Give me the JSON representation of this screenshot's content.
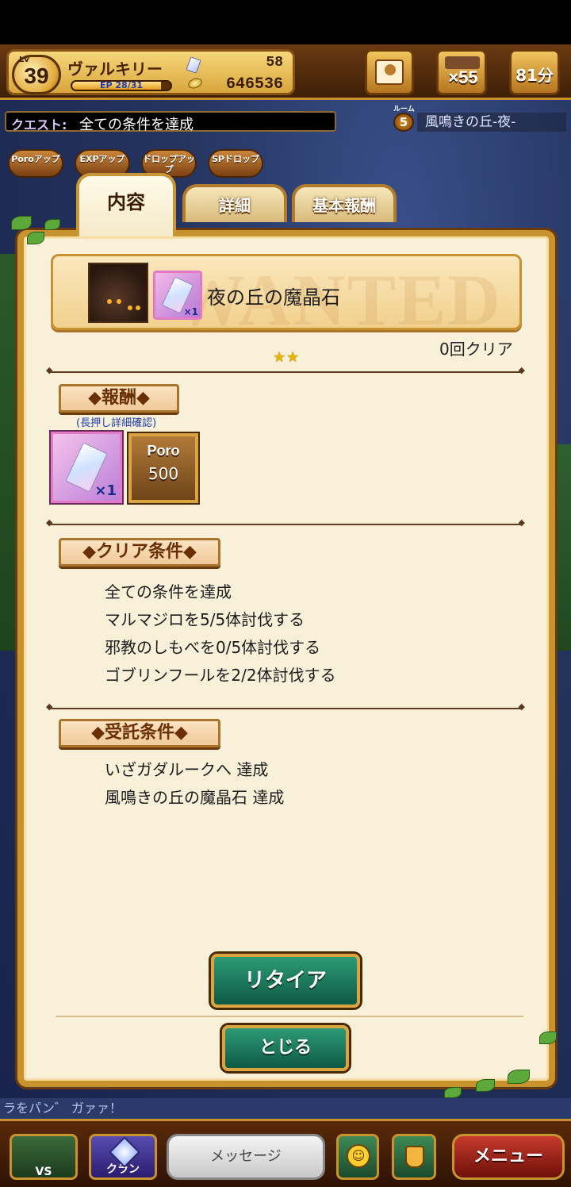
{
  "player": {
    "level_prefix": "Lv",
    "level": "39",
    "name": "ヴァルキリー",
    "ep_label": "EP",
    "ep_text": "28/31",
    "ep_fraction": 0.9,
    "gems": "58",
    "coins": "646536"
  },
  "top_buttons": {
    "tickets": "×55",
    "timer": "81分"
  },
  "quest_bar": {
    "label": "クエスト:",
    "text": "全ての条件を達成",
    "room_label": "ルーム",
    "room_number": "5",
    "area_name": "風鳴きの丘-夜-"
  },
  "boosts": [
    "Poroアップ",
    "EXPアップ",
    "ドロップアップ",
    "SPドロップ"
  ],
  "tabs": {
    "content": "内容",
    "detail": "詳細",
    "base_reward": "基本報酬"
  },
  "quest": {
    "watermark": "WANTED",
    "title": "夜の丘の魔晶石",
    "item_qty": "×1",
    "clear_count": "0回クリア",
    "stars": "★★"
  },
  "reward": {
    "heading": "報酬",
    "note": "(長押し詳細確認)",
    "crystal_qty": "×1",
    "poro_label": "Poro",
    "poro_amount": "500"
  },
  "clear_conditions": {
    "heading": "クリア条件",
    "items": [
      "全ての条件を達成",
      "マルマジロを5/5体討伐する",
      "邪教のしもべを0/5体討伐する",
      "ゴブリンフールを2/2体討伐する"
    ]
  },
  "accept_conditions": {
    "heading": "受託条件",
    "items": [
      "いざガダルークへ 達成",
      "風鳴きの丘の魔晶石 達成"
    ]
  },
  "buttons": {
    "retire": "リタイア",
    "close": "とじる"
  },
  "chat_strip": "ラをパン゛ ガァァ！",
  "bottom": {
    "vs": "VS",
    "clan": "クラン",
    "message": "メッセージ",
    "emote": "☺",
    "menu": "メニュー"
  }
}
